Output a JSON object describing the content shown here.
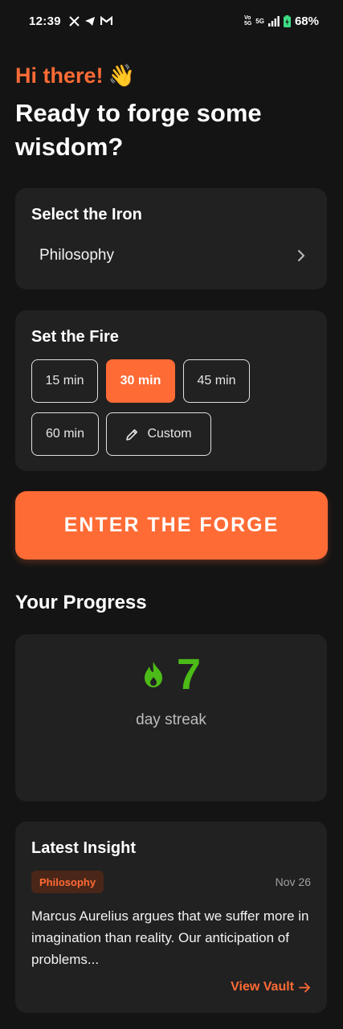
{
  "status_bar": {
    "time": "12:39",
    "network_top": "Vo",
    "network_bottom": "5G",
    "signal_label": "5G",
    "battery": "68%"
  },
  "greeting": {
    "text": "Hi there!",
    "emoji": "👋",
    "headline": "Ready to forge some wisdom?"
  },
  "iron": {
    "title": "Select the Iron",
    "selected": "Philosophy"
  },
  "fire": {
    "title": "Set the Fire",
    "options": [
      "15 min",
      "30 min",
      "45 min",
      "60 min"
    ],
    "selected": "30 min",
    "custom_label": "Custom"
  },
  "forge_button": {
    "label": "ENTER THE FORGE"
  },
  "progress": {
    "title": "Your Progress",
    "streak_value": "7",
    "streak_label": "day streak"
  },
  "insight": {
    "title": "Latest Insight",
    "tag": "Philosophy",
    "date": "Nov 26",
    "text": "Marcus Aurelius argues that we suffer more in imagination than reality. Our anticipation of problems...",
    "link_label": "View Vault"
  },
  "colors": {
    "accent": "#ff6b35",
    "streak": "#4cbb17",
    "background": "#141414",
    "card": "#212121"
  }
}
